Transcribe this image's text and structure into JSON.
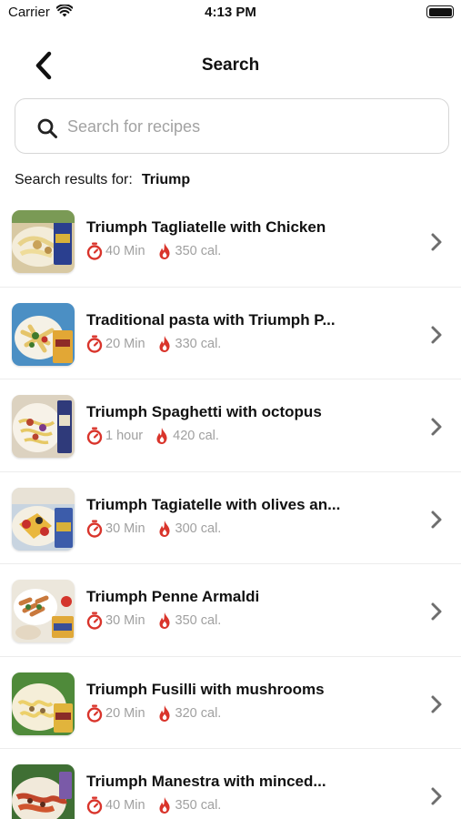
{
  "status_bar": {
    "carrier": "Carrier",
    "time": "4:13 PM"
  },
  "nav": {
    "title": "Search"
  },
  "search": {
    "placeholder": "Search for recipes",
    "value": ""
  },
  "results": {
    "label": "Search results for:",
    "query": "Triump"
  },
  "colors": {
    "accent": "#d9342b",
    "muted": "#a0a0a0"
  },
  "recipes": [
    {
      "title": "Triumph Tagliatelle with Chicken",
      "time": "40 Min",
      "calories": "350 cal."
    },
    {
      "title": "Traditional pasta with Triumph P...",
      "time": "20 Min",
      "calories": "330 cal."
    },
    {
      "title": "Triumph Spaghetti with octopus",
      "time": "1 hour",
      "calories": "420 cal."
    },
    {
      "title": "Triumph Tagiatelle with olives an...",
      "time": "30 Min",
      "calories": "300 cal."
    },
    {
      "title": "Triumph Penne Armaldi",
      "time": "30 Min",
      "calories": "350 cal."
    },
    {
      "title": "Triumph Fusilli with mushrooms",
      "time": "20 Min",
      "calories": "320 cal."
    },
    {
      "title": "Triumph Manestra with minced...",
      "time": "40 Min",
      "calories": "350 cal."
    }
  ]
}
